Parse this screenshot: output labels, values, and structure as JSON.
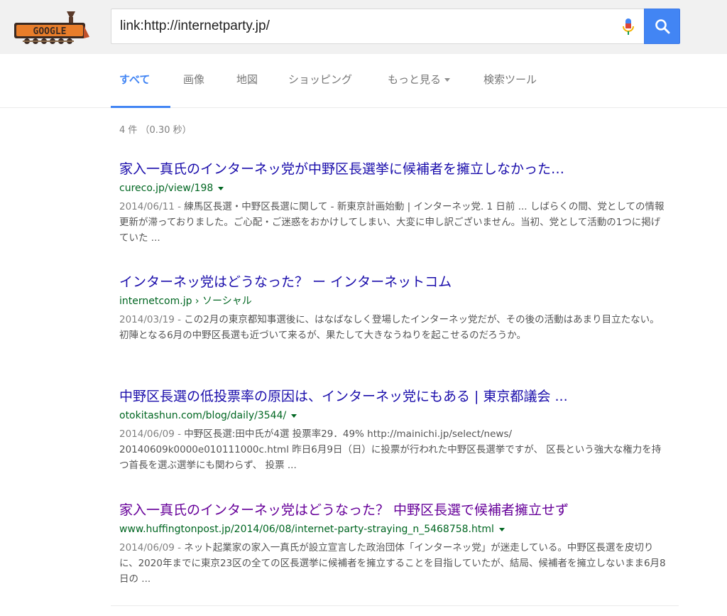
{
  "header": {
    "logo_text": "GOOGLE",
    "search_value": "link:http://internetparty.jp/"
  },
  "tabs": [
    {
      "label": "すべて"
    },
    {
      "label": "画像"
    },
    {
      "label": "地図"
    },
    {
      "label": "ショッピング"
    },
    {
      "label": "もっと見る"
    },
    {
      "label": "検索ツール"
    }
  ],
  "result_count": "4 件 （0.30 秒）",
  "results": [
    {
      "title": "家入一真氏のインターネッ党が中野区長選挙に候補者を擁立しなかった…",
      "url": "cureco.jp/view/198",
      "date": "2014/06/11 - ",
      "snippet": "練馬区長選・中野区長選に関して - 新東京計画始動 | インターネッ党. 1 日前 ... しばらくの間、党としての情報更新が滞っておりました。ご心配・ご迷惑をおかけしてしまい、大変に申し訳ございません。当初、党として活動の1つに掲げていた ..."
    },
    {
      "title": "インターネッ党はどうなった？ ー インターネットコム",
      "url": "internetcom.jp › ソーシャル",
      "date": "2014/03/19 - ",
      "snippet": "この2月の東京都知事選後に、はなばなしく登場したインターネッ党だが、その後の活動はあまり目立たない。初陣となる6月の中野区長選も近づいて来るが、果たして大きなうねりを起こせるのだろうか。"
    },
    {
      "title": "中野区長選の低投票率の原因は、インターネッ党にもある | 東京都議会 ...",
      "url": "otokitashun.com/blog/daily/3544/",
      "date": "2014/06/09 - ",
      "snippet": "中野区長選:田中氏が4選 投票率29．49% http://mainichi.jp/select/news/ 20140609k0000e010111000c.html 昨日6月9日（日）に投票が行われた中野区長選挙ですが、 区長という強大な権力を持つ首長を選ぶ選挙にも関わらず、 投票 ..."
    },
    {
      "title": "家入一真氏のインターネッ党はどうなった？ 中野区長選で候補者擁立せず",
      "url": "www.huffingtonpost.jp/2014/06/08/internet-party-straying_n_5468758.html",
      "date": "2014/06/09 - ",
      "snippet": "ネット起業家の家入一真氏が設立宣言した政治団体「インターネッ党」が迷走している。中野区長選を皮切りに、2020年までに東京23区の全ての区長選挙に候補者を擁立することを目指していたが、結局、候補者を擁立しないまま6月8日の ..."
    }
  ],
  "colors": {
    "accent": "#4285f4",
    "link": "#1a0dab",
    "visited": "#660099",
    "url_green": "#006621"
  }
}
